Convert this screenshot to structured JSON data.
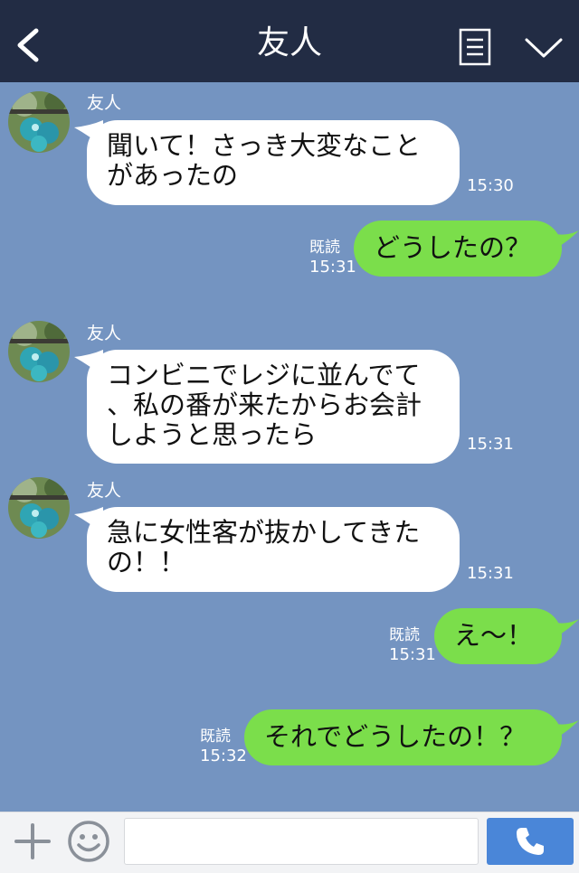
{
  "header": {
    "title": "友人"
  },
  "friend_name": "友人",
  "messages": [
    {
      "side": "left",
      "text": "聞いて！さっき大変なこと\nがあったの",
      "time": "15:30"
    },
    {
      "side": "right",
      "text": "どうしたの？",
      "read": "既読",
      "time": "15:31"
    },
    {
      "side": "left",
      "text": "コンビニでレジに並んでて\n、私の番が来たからお会計\nしようと思ったら",
      "time": "15:31"
    },
    {
      "side": "left",
      "text": "急に女性客が抜かしてきた\nの！！",
      "time": "15:31"
    },
    {
      "side": "right",
      "text": "え〜！",
      "read": "既読",
      "time": "15:31"
    },
    {
      "side": "right",
      "text": "それでどうしたの！？",
      "read": "既読",
      "time": "15:32"
    }
  ],
  "input": {
    "placeholder": ""
  },
  "colors": {
    "header": "#222c44",
    "background": "#7494c1",
    "sent_bubble": "#7bde4b",
    "received_bubble": "#ffffff",
    "call_button": "#4a86d8"
  },
  "icons": [
    "back-icon",
    "menu-icon",
    "chevron-down-icon",
    "plus-icon",
    "emoji-icon",
    "phone-icon"
  ]
}
